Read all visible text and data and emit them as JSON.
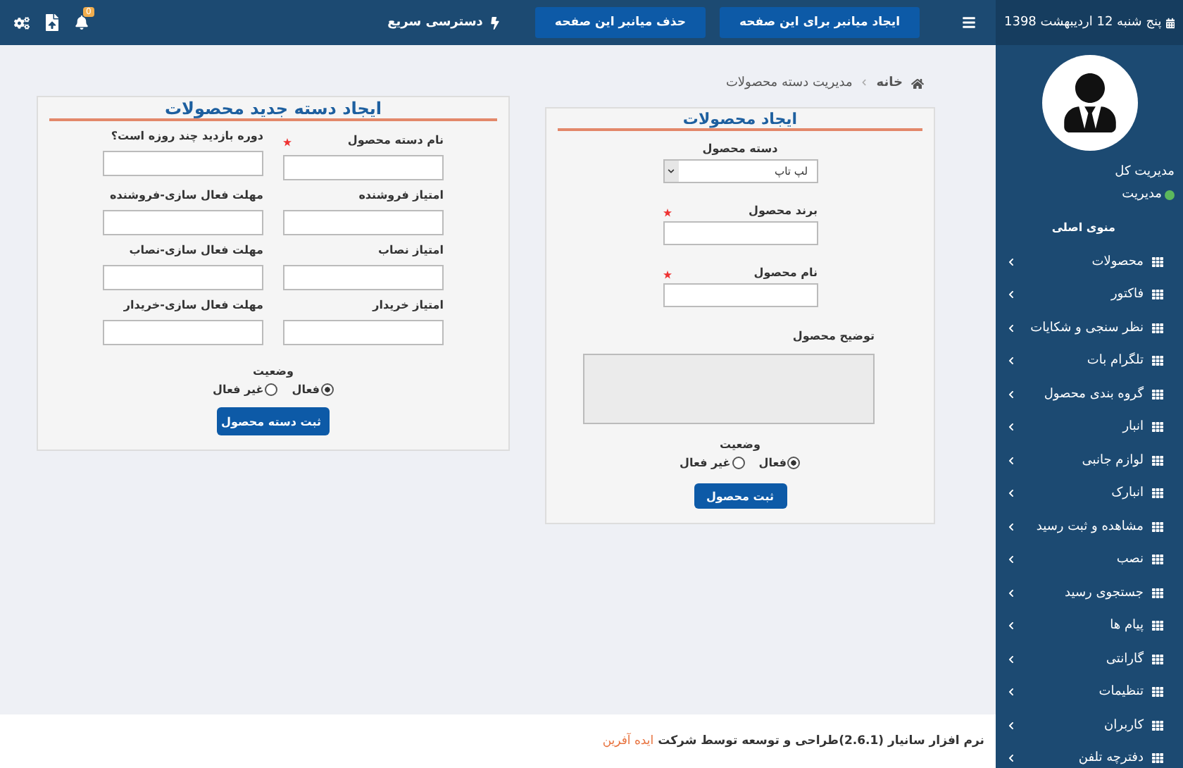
{
  "sidebar": {
    "date": "پنج شنبه 12 اردیبهشت 1398",
    "role": "مدیریت کل",
    "status": {
      "label": "مدیریت",
      "color": "#5cb85c"
    },
    "menu_title": "منوی اصلی",
    "items": [
      {
        "label": "محصولات"
      },
      {
        "label": "فاکتور"
      },
      {
        "label": "نظر سنجی و شکایات"
      },
      {
        "label": "تلگرام بات"
      },
      {
        "label": "گروه بندی محصول"
      },
      {
        "label": "انبار"
      },
      {
        "label": "لوازم جانبی"
      },
      {
        "label": "انبارک"
      },
      {
        "label": "مشاهده و ثبت رسید"
      },
      {
        "label": "نصب"
      },
      {
        "label": "جستجوی رسید"
      },
      {
        "label": "پیام ها"
      },
      {
        "label": "گارانتی"
      },
      {
        "label": "تنظیمات"
      },
      {
        "label": "کاربران"
      },
      {
        "label": "دفترچه تلفن"
      }
    ]
  },
  "topbar": {
    "buttons": [
      "ایجاد میانبر برای این صفحه",
      "حذف میانبر این صفحه"
    ],
    "quick_access": "دسترسی سریع",
    "notifications": "0"
  },
  "breadcrumb": [
    "خانه",
    "مدیریت دسته محصولات"
  ],
  "product_form": {
    "title": "ایجاد محصولات",
    "fields": [
      {
        "kind": "select",
        "label": "دسته محصول",
        "value": "لپ تاپ",
        "required": false
      },
      {
        "kind": "text",
        "label": "برند محصول",
        "required": true
      },
      {
        "kind": "text",
        "label": "نام محصول",
        "required": true
      },
      {
        "kind": "textarea",
        "label": "توضیح محصول",
        "required": false
      }
    ],
    "status_label": "وضعیت",
    "options": [
      {
        "label": "فعال",
        "selected": true
      },
      {
        "label": "غیر فعال",
        "selected": false
      }
    ],
    "submit": "ثبت محصول"
  },
  "category_form": {
    "title": "ایجاد دسته جدید محصولات",
    "fields": [
      {
        "label": "نام دسته محصول",
        "required": true
      },
      {
        "label": "دوره بازدید چند روزه است؟",
        "required": false
      },
      {
        "label": "امتیاز فروشنده",
        "required": false
      },
      {
        "label": "مهلت فعال سازی-فروشنده",
        "required": false
      },
      {
        "label": "امتیاز نصاب",
        "required": false
      },
      {
        "label": "مهلت فعال سازی-نصاب",
        "required": false
      },
      {
        "label": "امتیاز خریدار",
        "required": false
      },
      {
        "label": "مهلت فعال سازی-خریدار",
        "required": false
      }
    ],
    "status_label": "وضعیت",
    "options": [
      {
        "label": "فعال",
        "selected": true
      },
      {
        "label": "غیر فعال",
        "selected": false
      }
    ],
    "submit": "ثبت دسته محصول"
  },
  "footer": {
    "text": "نرم افزار سانیار (2.6.1)طراحی و توسعه توسط شرکت",
    "company": "ایده آفرین"
  }
}
